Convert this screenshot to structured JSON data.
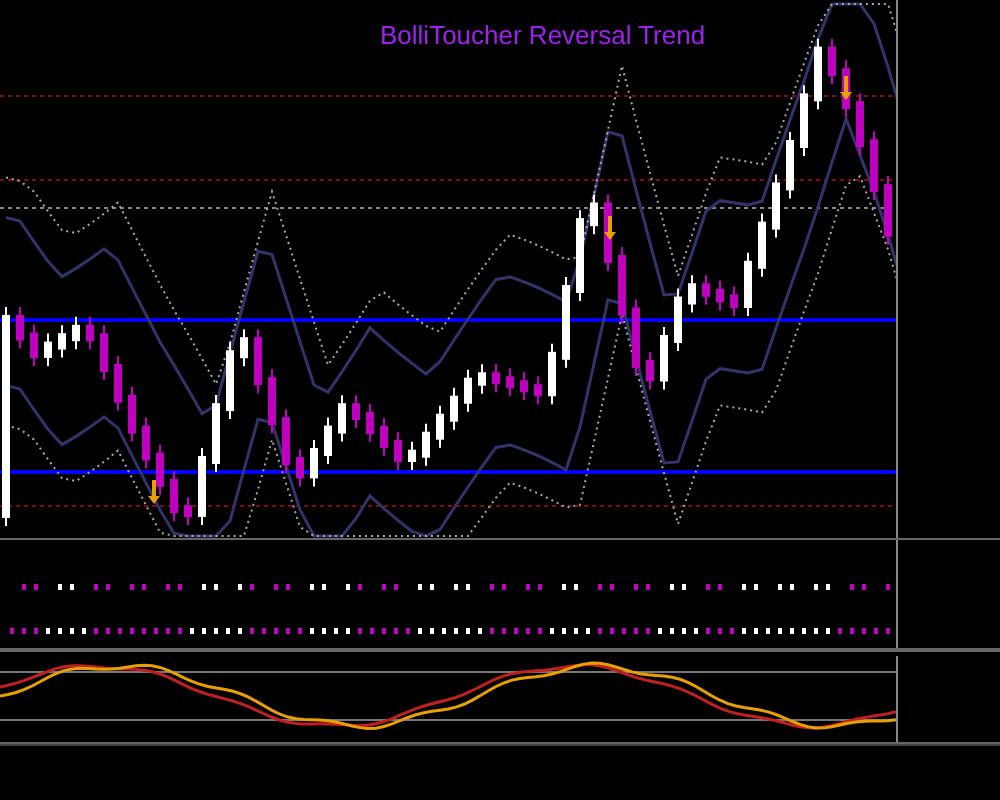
{
  "chart": {
    "title": "BolliToucher Reversal Trend"
  }
}
